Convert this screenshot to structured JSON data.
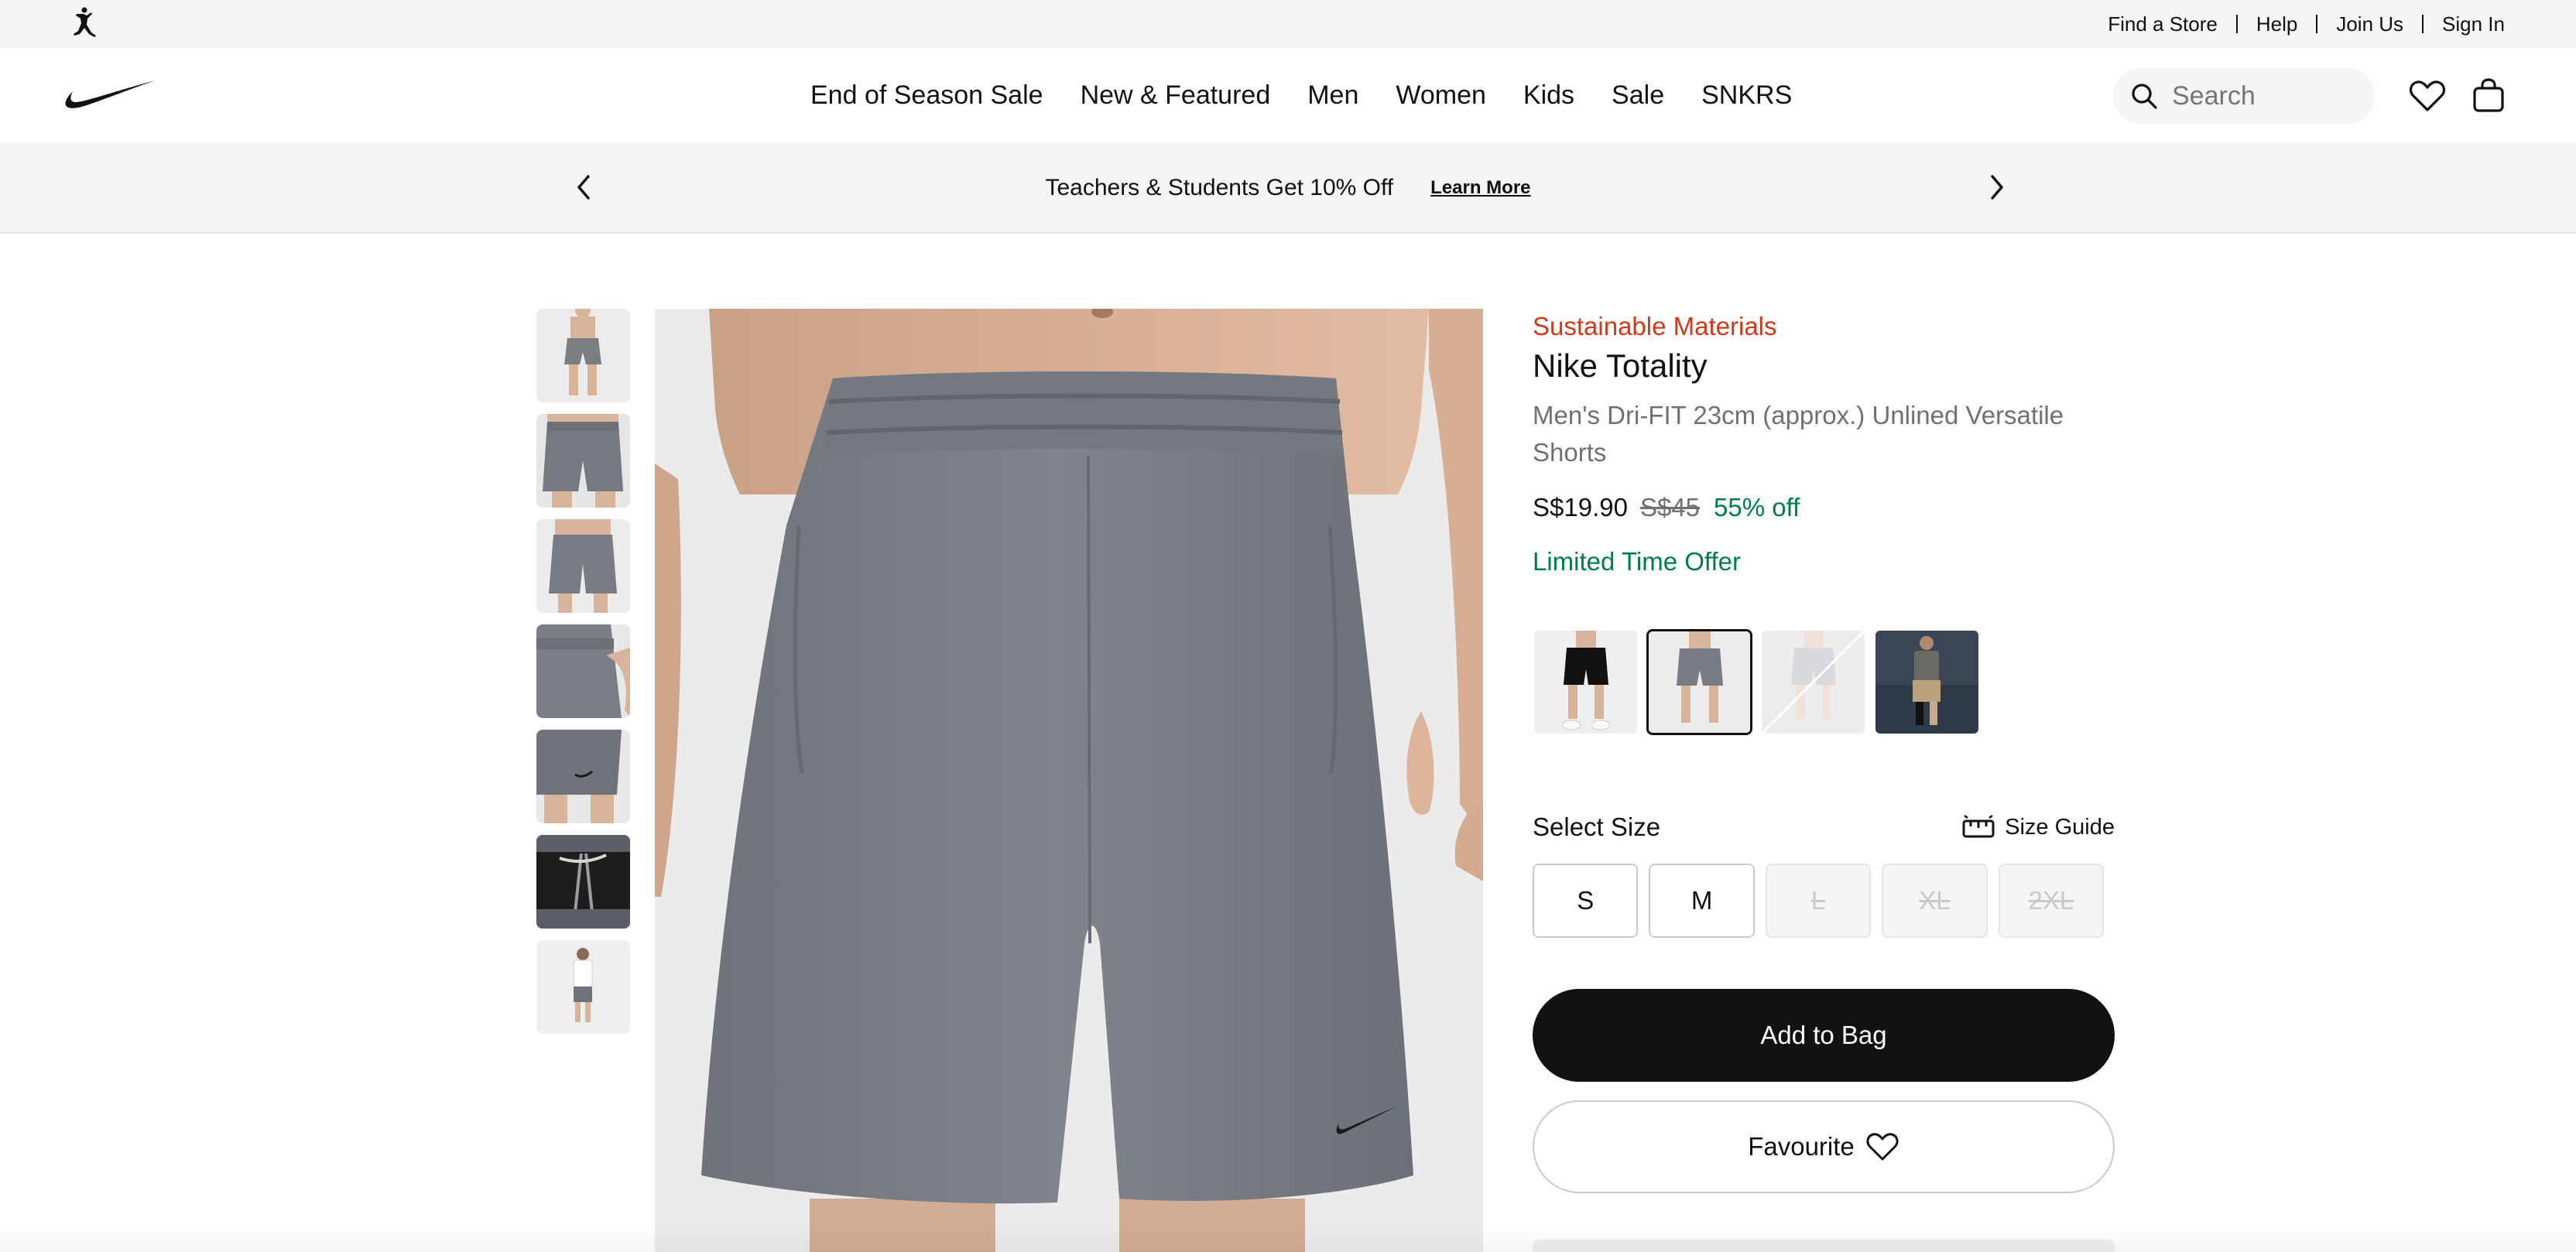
{
  "utility": {
    "links": [
      "Find a Store",
      "Help",
      "Join Us",
      "Sign In"
    ]
  },
  "nav": {
    "links": [
      "End of Season Sale",
      "New & Featured",
      "Men",
      "Women",
      "Kids",
      "Sale",
      "SNKRS"
    ],
    "search_placeholder": "Search"
  },
  "promo": {
    "text": "Teachers & Students Get 10% Off",
    "link": "Learn More"
  },
  "product": {
    "badge": "Sustainable Materials",
    "title": "Nike Totality",
    "subtitle": "Men's Dri-FIT 23cm (approx.) Unlined Versatile Shorts",
    "price": "S$19.90",
    "original_price": "S$45",
    "discount": "55% off",
    "offer": "Limited Time Offer",
    "colorways": [
      {
        "name": "black",
        "selected": false,
        "unavailable": false
      },
      {
        "name": "grey",
        "selected": true,
        "unavailable": false
      },
      {
        "name": "light-grey",
        "selected": false,
        "unavailable": true
      },
      {
        "name": "khaki",
        "selected": false,
        "unavailable": false
      }
    ],
    "size_title": "Select Size",
    "size_guide": "Size Guide",
    "sizes": [
      {
        "label": "S",
        "available": true
      },
      {
        "label": "M",
        "available": true
      },
      {
        "label": "L",
        "available": false
      },
      {
        "label": "XL",
        "available": false
      },
      {
        "label": "2XL",
        "available": false
      }
    ],
    "add_to_bag": "Add to Bag",
    "favourite": "Favourite"
  },
  "colors": {
    "accent_sale": "#d33918",
    "accent_green": "#007d48",
    "text": "#111111",
    "muted": "#707072"
  }
}
